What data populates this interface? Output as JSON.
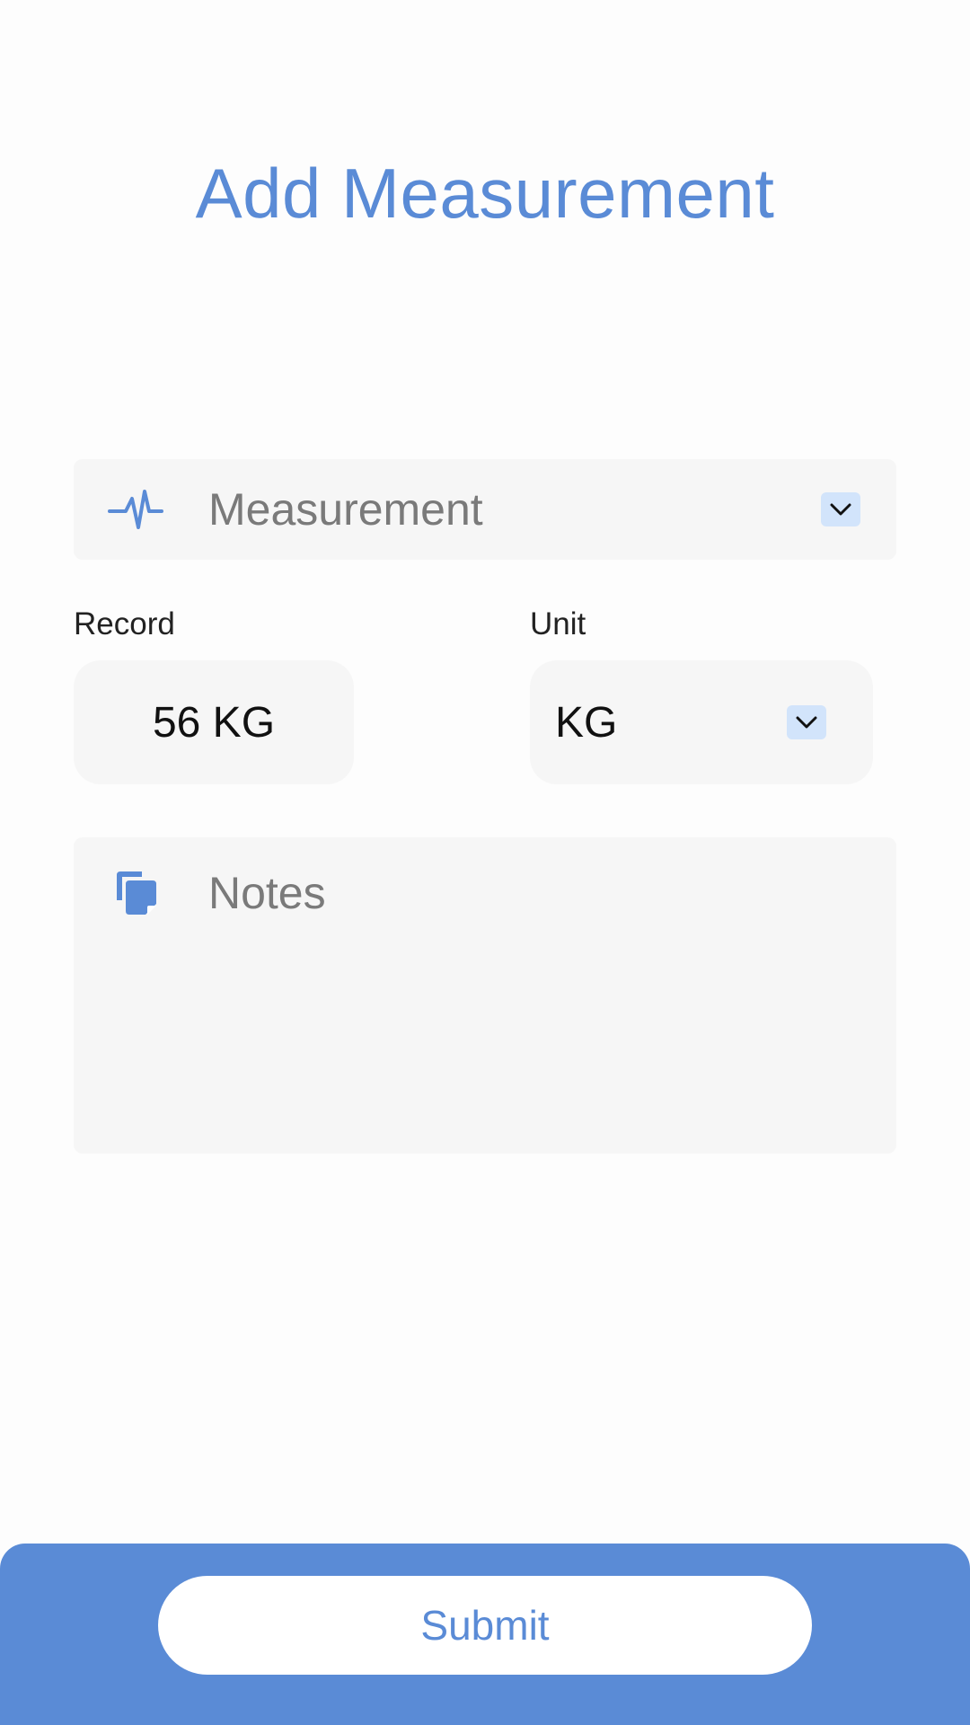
{
  "page_title": "Add Measurement",
  "colors": {
    "accent": "#5a8bd6",
    "field_bg": "#f6f6f6",
    "dropdown_chip": "#d2e4fb"
  },
  "measurement_field": {
    "placeholder": "Measurement",
    "icon": "pulse-icon",
    "dropdown_icon": "chevron-down-icon"
  },
  "record": {
    "label": "Record",
    "value": "56 KG"
  },
  "unit": {
    "label": "Unit",
    "value": "KG",
    "dropdown_icon": "chevron-down-icon"
  },
  "notes": {
    "placeholder": "Notes",
    "icon": "notes-icon"
  },
  "footer": {
    "submit_label": "Submit"
  }
}
